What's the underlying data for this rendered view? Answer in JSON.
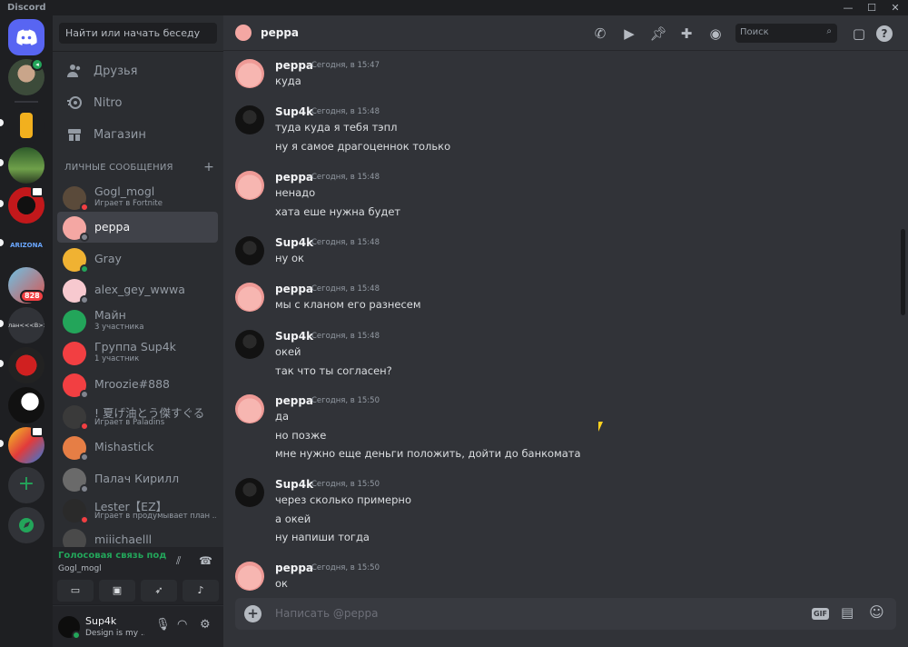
{
  "window": {
    "title": "Discord",
    "controls": [
      "—",
      "☐",
      "✕"
    ]
  },
  "sidebar": {
    "search_placeholder": "Найти или начать беседу",
    "nav": [
      {
        "label": "Друзья",
        "icon": "friends-icon"
      },
      {
        "label": "Nitro",
        "icon": "nitro-icon"
      },
      {
        "label": "Магазин",
        "icon": "shop-icon"
      }
    ],
    "dm_header": "ЛИЧНЫЕ СООБЩЕНИЯ",
    "dm_add": "+",
    "dms": [
      {
        "name": "Gogl_mogl",
        "sub": "Играет в Fortnite",
        "status": "dnd",
        "avatar": "#5a4a3a"
      },
      {
        "name": "peppa",
        "sub": "",
        "status": "offline",
        "avatar": "#f4a7a3",
        "active": true
      },
      {
        "name": "Gray",
        "sub": "",
        "status": "online",
        "avatar": "#f0b232"
      },
      {
        "name": "alex_gey_wwwa",
        "sub": "",
        "status": "offline",
        "avatar": "#f7c9cf"
      },
      {
        "name": "Майн",
        "sub": "3 участника",
        "status": "",
        "avatar": "#23a55a"
      },
      {
        "name": "Группа Sup4k",
        "sub": "1 участник",
        "status": "",
        "avatar": "#f23f42"
      },
      {
        "name": "Mroozie#888",
        "sub": "",
        "status": "offline",
        "avatar": "#f23f42"
      },
      {
        "name": "! 夏げ油とう傑すぐる",
        "sub": "Играет в Paladins",
        "status": "dnd",
        "avatar": "#3a3a3a"
      },
      {
        "name": "Mishastick",
        "sub": "",
        "status": "offline",
        "avatar": "#e67e45"
      },
      {
        "name": "Палач Кирилл",
        "sub": "",
        "status": "offline",
        "avatar": "#6a6a6a"
      },
      {
        "name": "Lester【EZ】",
        "sub": "Играет в продумывает план ...",
        "status": "dnd",
        "avatar": "#2a2a2a"
      },
      {
        "name": "miiichaelll",
        "sub": "",
        "status": "",
        "avatar": "#4a4a4a"
      }
    ],
    "voice": {
      "title": "Голосовая связь под",
      "server": "Gogl_mogl"
    },
    "user": {
      "name": "Sup4k",
      "status": "Design is my ..."
    }
  },
  "guilds": {
    "badge_count": "828",
    "add_label": "+",
    "clan_label": "лан<<<В>>"
  },
  "chat": {
    "header_name": "peppa",
    "search_placeholder": "Поиск",
    "composer_placeholder": "Написать @peppa",
    "gif_label": "GIF",
    "messages": [
      {
        "author": "peppa",
        "time": "Сегодня, в 15:47",
        "lines": [
          "куда"
        ]
      },
      {
        "author": "Sup4k",
        "time": "Сегодня, в 15:48",
        "lines": [
          "туда куда я тебя тэпл",
          "ну я самое драгоценнок только"
        ]
      },
      {
        "author": "peppa",
        "time": "Сегодня, в 15:48",
        "lines": [
          "ненадо",
          "хата еше нужна будет"
        ]
      },
      {
        "author": "Sup4k",
        "time": "Сегодня, в 15:48",
        "lines": [
          "ну ок"
        ]
      },
      {
        "author": "peppa",
        "time": "Сегодня, в 15:48",
        "lines": [
          "мы с кланом его разнесем"
        ]
      },
      {
        "author": "Sup4k",
        "time": "Сегодня, в 15:48",
        "lines": [
          "окей",
          "так что ты согласен?"
        ]
      },
      {
        "author": "peppa",
        "time": "Сегодня, в 15:50",
        "lines": [
          "да",
          "но позже",
          "мне нужно еще деньги положить, дойти до банкомата"
        ]
      },
      {
        "author": "Sup4k",
        "time": "Сегодня, в 15:50",
        "lines": [
          "через сколько примерно",
          "а окей",
          "ну напиши тогда"
        ]
      },
      {
        "author": "peppa",
        "time": "Сегодня, в 15:50",
        "lines": [
          "ок"
        ]
      }
    ]
  },
  "colors": {
    "accent": "#5865f2",
    "online": "#23a55a",
    "dnd": "#f23f42",
    "offline": "#80848e"
  }
}
